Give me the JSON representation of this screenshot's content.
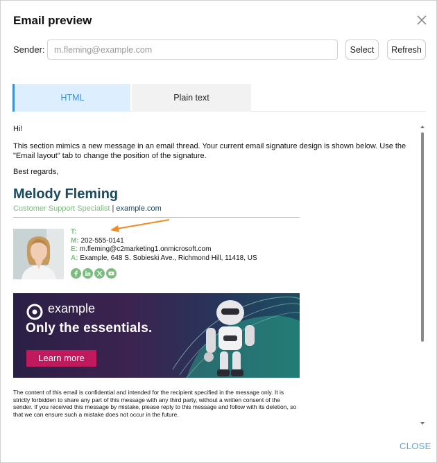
{
  "dialog": {
    "title": "Email preview",
    "close_label": "CLOSE"
  },
  "sender": {
    "label": "Sender:",
    "placeholder": "m.fleming@example.com",
    "value": "",
    "select_label": "Select",
    "refresh_label": "Refresh"
  },
  "tabs": [
    {
      "label": "HTML",
      "active": true
    },
    {
      "label": "Plain text",
      "active": false
    }
  ],
  "preview": {
    "greeting": "Hi!",
    "body": "This section mimics a new message in an email thread. Your current email signature design is shown below. Use the \"Email layout\" tab to change the position of the signature.",
    "regards": "Best regards,",
    "signature": {
      "name": "Melody Fleming",
      "role": "Customer Support Specialist",
      "separator": "|",
      "website": "example.com",
      "contact": {
        "t_label": "T:",
        "t_value": "",
        "m_label": "M:",
        "m_value": "202-555-0141",
        "e_label": "E:",
        "e_value": "m.fleming@c2marketing1.onmicrosoft.com",
        "a_label": "A:",
        "a_value": "Example, 648 S. Sobieski Ave., Richmond Hill, 11418, US"
      },
      "social_icons": [
        "facebook-icon",
        "linkedin-icon",
        "x-icon",
        "youtube-icon"
      ],
      "accent_color": "#7cbc7f",
      "name_color": "#1b4a5e"
    },
    "banner": {
      "brand": "example",
      "headline": "Only the essentials.",
      "cta": "Learn more",
      "cta_color": "#c0195d"
    },
    "disclaimer": "The content of this email is confidential and intended for the recipient specified in the message only. It is strictly forbidden to share any part of this message with any third party, without a written consent of the sender. If you received this message by mistake, please reply to this message and follow with its deletion, so that we can ensure such a mistake does not occur in the future."
  },
  "colors": {
    "tab_active_bg": "#ddeefe",
    "tab_active_text": "#3b8ed8",
    "close_text": "#5aa7e6",
    "annotation_arrow": "#f08a24"
  }
}
